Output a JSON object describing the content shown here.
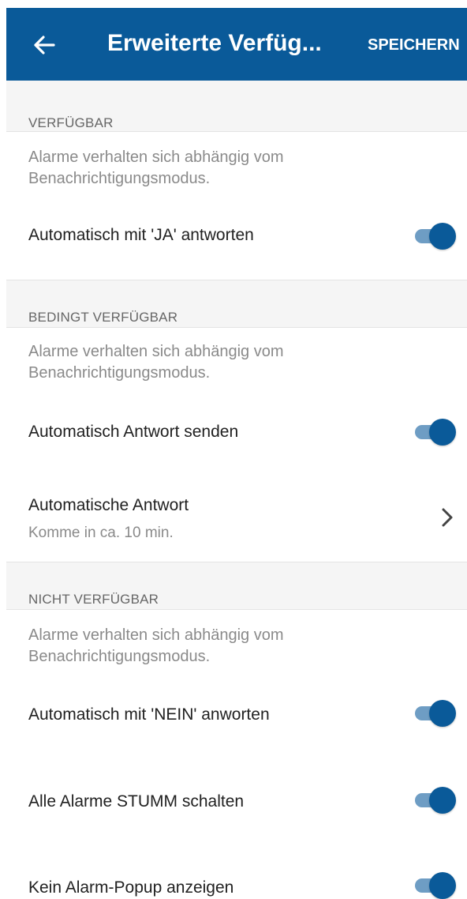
{
  "appbar": {
    "back_icon": "arrow-left-icon",
    "title": "Erweiterte Verfüg...",
    "save_label": "SPEICHERN",
    "color": "#0a5a99"
  },
  "sections": {
    "available": {
      "header": "VERFÜGBAR",
      "description": "Alarme verhalten sich abhängig vom Benachrichtigungsmodus.",
      "auto_yes": {
        "label": "Automatisch mit 'JA' antworten",
        "on": true
      }
    },
    "conditional": {
      "header": "BEDINGT VERFÜGBAR",
      "description": "Alarme verhalten sich abhängig vom Benachrichtigungsmodus.",
      "auto_send": {
        "label": "Automatisch Antwort senden",
        "on": true
      },
      "auto_reply": {
        "label": "Automatische Antwort",
        "value": "Komme in ca. 10 min."
      }
    },
    "unavailable": {
      "header": "NICHT VERFÜGBAR",
      "description": "Alarme verhalten sich abhängig vom Benachrichtigungsmodus.",
      "auto_no": {
        "label": "Automatisch mit 'NEIN' anworten",
        "on": true
      },
      "mute_all": {
        "label": "Alle Alarme STUMM schalten",
        "on": true
      },
      "no_popup": {
        "label": "Kein Alarm-Popup anzeigen",
        "on": true
      }
    }
  }
}
